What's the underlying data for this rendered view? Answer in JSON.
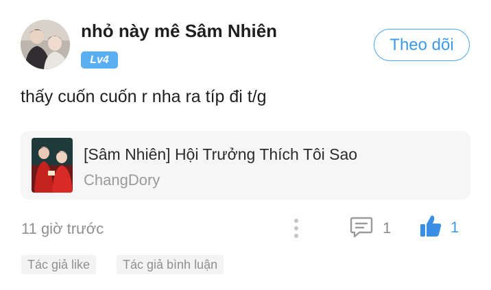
{
  "comment": {
    "username": "nhỏ này mê Sâm Nhiên",
    "level_badge": "Lv4",
    "follow_label": "Theo dõi",
    "text": "thấy cuốn cuốn r nha ra típ đi t/g",
    "story": {
      "title": "[Sâm Nhiên] Hội Trưởng Thích Tôi Sao",
      "author": "ChangDory"
    },
    "time": "11 giờ trước",
    "reply_count": "1",
    "like_count": "1",
    "tags": [
      "Tác giả like",
      "Tác giả bình luận"
    ]
  },
  "icons": {
    "more": "more-vertical-icon",
    "comment": "comment-icon",
    "like": "thumbs-up-icon"
  },
  "colors": {
    "accent": "#3a9aea",
    "badge": "#5aaef2",
    "muted": "#8f8f8f",
    "card_bg": "#f6f6f6"
  }
}
